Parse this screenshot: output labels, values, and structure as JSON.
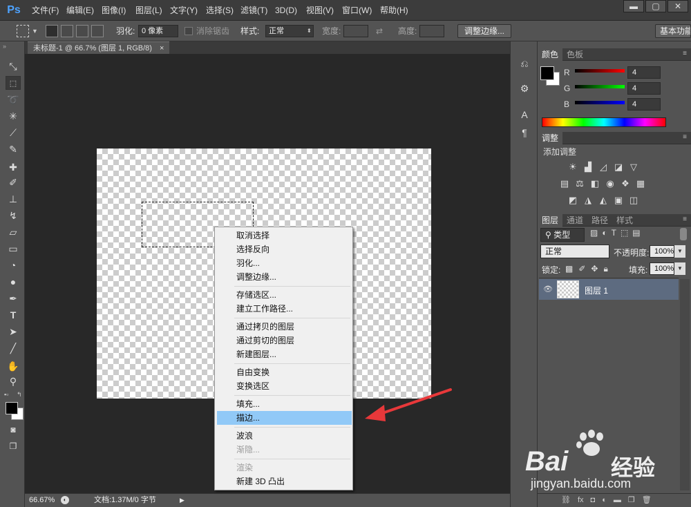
{
  "app": {
    "logo": "Ps"
  },
  "menubar": {
    "items": [
      "文件(F)",
      "编辑(E)",
      "图像(I)",
      "图层(L)",
      "文字(Y)",
      "选择(S)",
      "滤镜(T)",
      "3D(D)",
      "视图(V)",
      "窗口(W)",
      "帮助(H)"
    ],
    "window_controls": [
      "▬",
      "▢",
      "✕"
    ]
  },
  "options": {
    "feather_label": "羽化:",
    "feather_value": "0 像素",
    "antialias_label": "消除锯齿",
    "style_label": "样式:",
    "style_value": "正常",
    "width_label": "宽度:",
    "height_label": "高度:",
    "refine_button": "调整边缘...",
    "workspace_button": "基本功能"
  },
  "document": {
    "tab_title": "未标题-1 @ 66.7% (图层 1, RGB/8)",
    "tab_close": "×"
  },
  "statusbar": {
    "zoom": "66.67%",
    "doc_info": "文档:1.37M/0 字节"
  },
  "context_menu": {
    "groups": [
      [
        "取消选择",
        "选择反向",
        "羽化...",
        "调整边缘..."
      ],
      [
        "存储选区...",
        "建立工作路径..."
      ],
      [
        "通过拷贝的图层",
        "通过剪切的图层",
        "新建图层..."
      ],
      [
        "自由变换",
        "变换选区"
      ],
      [
        "填充...",
        "描边..."
      ],
      [
        "波浪",
        "渐隐..."
      ],
      [
        "渲染",
        "新建 3D 凸出"
      ]
    ],
    "highlighted": "描边...",
    "disabled": [
      "渐隐...",
      "渲染"
    ]
  },
  "color_panel": {
    "tabs": [
      "颜色",
      "色板"
    ],
    "channels": [
      {
        "label": "R",
        "value": "4",
        "color": "#ff0000"
      },
      {
        "label": "G",
        "value": "4",
        "color": "#00ff00"
      },
      {
        "label": "B",
        "value": "4",
        "color": "#0000ff"
      }
    ]
  },
  "adjustments_panel": {
    "tab": "调整",
    "title": "添加调整"
  },
  "layers_panel": {
    "tabs": [
      "图层",
      "通道",
      "路径",
      "样式"
    ],
    "filter_kind": "类型",
    "blend_mode": "正常",
    "opacity_label": "不透明度:",
    "opacity_value": "100%",
    "lock_label": "锁定:",
    "fill_label": "填充:",
    "fill_value": "100%",
    "layers": [
      {
        "name": "图层 1",
        "visible": true
      }
    ]
  },
  "watermark": {
    "brand": "Bai",
    "brand_cn": "经验",
    "url": "jingyan.baidu.com"
  },
  "colors": {
    "accent_highlight": "#91c9f7",
    "arrow": "#e8383a",
    "layer_selected": "#5d6b80"
  }
}
